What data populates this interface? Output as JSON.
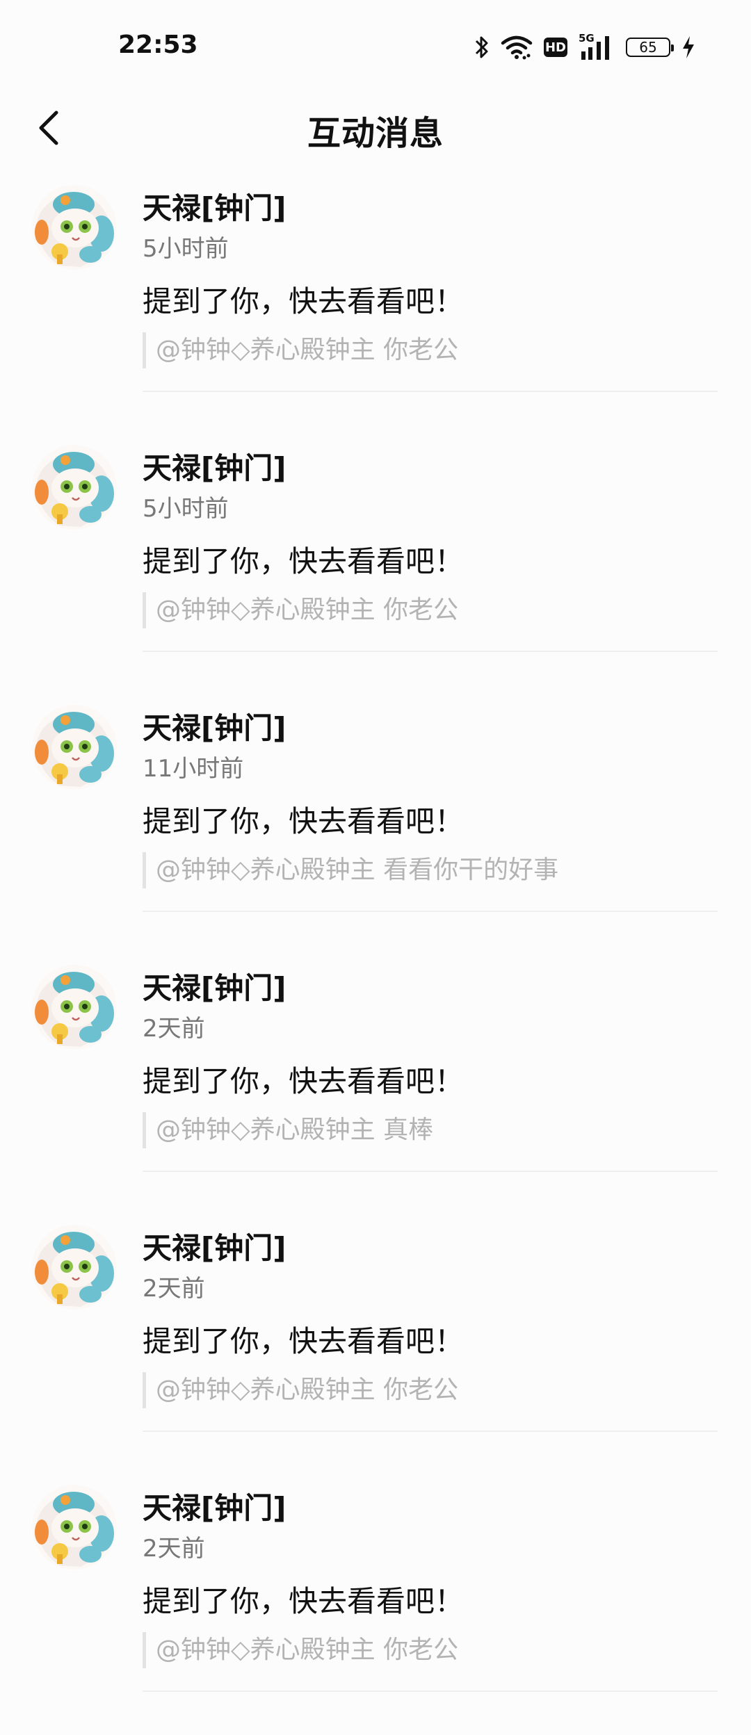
{
  "status_bar": {
    "time": "22:53",
    "hd_label": "HD",
    "network_label": "5G",
    "battery_level": "65",
    "icons": [
      "bluetooth-icon",
      "wifi-icon",
      "hd-icon",
      "signal-5g-icon",
      "battery-icon",
      "charging-icon"
    ]
  },
  "header": {
    "title": "互动消息",
    "back_icon": "chevron-left-icon"
  },
  "notifications": [
    {
      "name": "天禄[钟门]",
      "time": "5小时前",
      "message": "提到了你，快去看看吧！",
      "quote": "@钟钟◇养心殿钟主 你老公"
    },
    {
      "name": "天禄[钟门]",
      "time": "5小时前",
      "message": "提到了你，快去看看吧！",
      "quote": "@钟钟◇养心殿钟主 你老公"
    },
    {
      "name": "天禄[钟门]",
      "time": "11小时前",
      "message": "提到了你，快去看看吧！",
      "quote": "@钟钟◇养心殿钟主 看看你干的好事"
    },
    {
      "name": "天禄[钟门]",
      "time": "2天前",
      "message": "提到了你，快去看看吧！",
      "quote": "@钟钟◇养心殿钟主 真棒"
    },
    {
      "name": "天禄[钟门]",
      "time": "2天前",
      "message": "提到了你，快去看看吧！",
      "quote": "@钟钟◇养心殿钟主 你老公"
    },
    {
      "name": "天禄[钟门]",
      "time": "2天前",
      "message": "提到了你，快去看看吧！",
      "quote": "@钟钟◇养心殿钟主 你老公"
    }
  ]
}
